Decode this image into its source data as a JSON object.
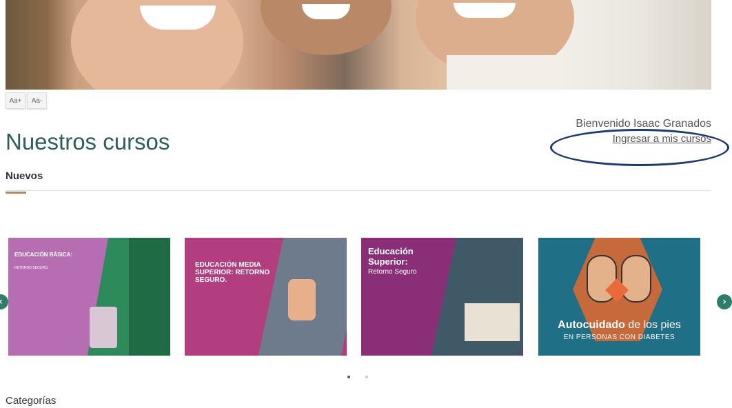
{
  "accessibility": {
    "font_increase_label": "Aa+",
    "font_decrease_label": "Aa-"
  },
  "user": {
    "welcome_text": "Bienvenido Isaac Granados",
    "my_courses_link": "Ingresar a mis cursos"
  },
  "page": {
    "title": "Nuestros cursos",
    "section_new": "Nuevos",
    "section_categories": "Categorías"
  },
  "carousel": {
    "cards": [
      {
        "title": "EDUCACIÓN BÁSICA:",
        "subtitle": "RETORNO SEGURO."
      },
      {
        "title": "EDUCACIÓN MEDIA SUPERIOR: RETORNO SEGURO."
      },
      {
        "title": "Educación Superior:",
        "subtitle": "Retorno Seguro"
      },
      {
        "title_bold": "Autocuidado",
        "title_rest": " de los pies",
        "subtitle": "EN PERSONAS CON DIABETES"
      }
    ],
    "prev_icon": "chevron-left-icon",
    "next_icon": "chevron-right-icon",
    "active_page": 1,
    "page_count": 2
  },
  "colors": {
    "title": "#2f5e57",
    "accent": "#b08a5a",
    "arrow": "#2e7d6a",
    "annotation": "#1f3a6e"
  }
}
